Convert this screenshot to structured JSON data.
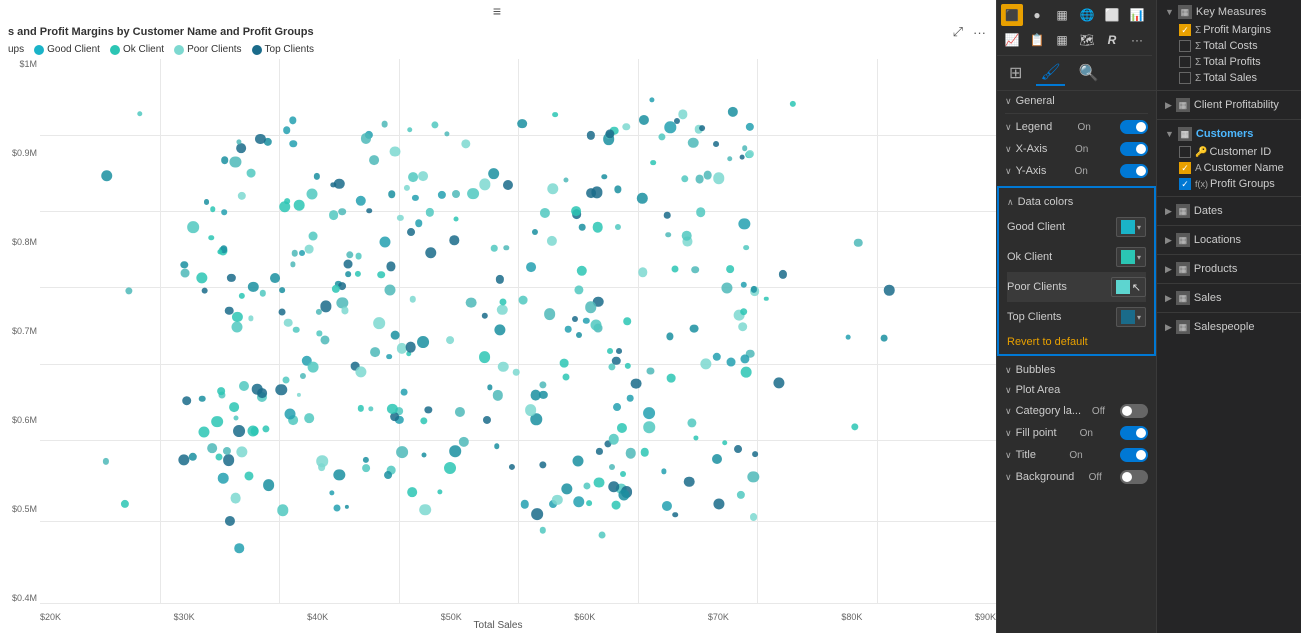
{
  "chart": {
    "title": "s and Profit Margins by Customer Name and Profit Groups",
    "x_axis_title": "Total Sales",
    "x_labels": [
      "$20K",
      "$30K",
      "$40K",
      "$50K",
      "$60K",
      "$70K",
      "$80K",
      "$90K"
    ],
    "legend_label": "ups",
    "legend_items": [
      {
        "label": "Good Client",
        "color": "#1ab3c8"
      },
      {
        "label": "Ok Client",
        "color": "#2bc5b4"
      },
      {
        "label": "Poor Clients",
        "color": "#5dd5d0"
      },
      {
        "label": "Top Clients",
        "color": "#1a6b8a"
      }
    ]
  },
  "format_panel": {
    "sections": [
      {
        "id": "general",
        "label": "General",
        "chevron": "∨",
        "type": "expand"
      },
      {
        "id": "legend",
        "label": "Legend",
        "chevron": "∨",
        "toggle": "on",
        "type": "toggle"
      },
      {
        "id": "x_axis",
        "label": "X-Axis",
        "chevron": "∨",
        "toggle": "on",
        "type": "toggle"
      },
      {
        "id": "y_axis",
        "label": "Y-Axis",
        "chevron": "∨",
        "toggle": "on",
        "type": "toggle"
      }
    ],
    "data_colors": {
      "header": "Data colors",
      "items": [
        {
          "label": "Good Client",
          "color": "#1ab3c8"
        },
        {
          "label": "Ok Client",
          "color": "#2bc5b4"
        },
        {
          "label": "Poor Clients",
          "color": "#5dd5d0"
        },
        {
          "label": "Top Clients",
          "color": "#1a6b8a"
        }
      ],
      "revert_label": "Revert to default"
    },
    "bottom_sections": [
      {
        "id": "bubbles",
        "label": "Bubbles",
        "chevron": "∨",
        "type": "expand"
      },
      {
        "id": "plot_area",
        "label": "Plot Area",
        "chevron": "∨",
        "type": "expand"
      },
      {
        "id": "category_label",
        "label": "Category la...",
        "chevron": "∨",
        "toggle": "off",
        "type": "toggle"
      },
      {
        "id": "fill_point",
        "label": "Fill point",
        "chevron": "∨",
        "toggle": "on",
        "type": "toggle"
      },
      {
        "id": "title",
        "label": "Title",
        "chevron": "∨",
        "toggle": "on",
        "type": "toggle"
      },
      {
        "id": "background",
        "label": "Background",
        "chevron": "∨",
        "toggle": "off",
        "type": "toggle"
      }
    ]
  },
  "field_list": {
    "sections": [
      {
        "id": "key_measures",
        "label": "Key Measures",
        "expanded": true,
        "chevron": "▼",
        "items": [
          {
            "label": "Profit Margins",
            "checked": true,
            "check_type": "yellow",
            "type": "measure"
          },
          {
            "label": "Total Costs",
            "checked": false,
            "type": "measure"
          },
          {
            "label": "Total Profits",
            "checked": false,
            "type": "measure"
          },
          {
            "label": "Total Sales",
            "checked": false,
            "type": "measure"
          }
        ]
      },
      {
        "id": "client_profitability",
        "label": "Client Profitability",
        "expanded": false,
        "chevron": "▶"
      },
      {
        "id": "customers",
        "label": "Customers",
        "expanded": true,
        "chevron": "▼",
        "highlighted": true,
        "items": [
          {
            "label": "Customer ID",
            "checked": false,
            "type": "field"
          },
          {
            "label": "Customer Name",
            "checked": true,
            "check_type": "yellow",
            "type": "field"
          },
          {
            "label": "Profit Groups",
            "checked": true,
            "check_type": "special",
            "type": "field"
          }
        ]
      },
      {
        "id": "dates",
        "label": "Dates",
        "expanded": false,
        "chevron": "▶"
      },
      {
        "id": "locations",
        "label": "Locations",
        "expanded": false,
        "chevron": "▶"
      },
      {
        "id": "products",
        "label": "Products",
        "expanded": false,
        "chevron": "▶"
      },
      {
        "id": "sales",
        "label": "Sales",
        "expanded": false,
        "chevron": "▶"
      },
      {
        "id": "salespeople",
        "label": "Salespeople",
        "expanded": false,
        "chevron": "▶"
      }
    ]
  },
  "toolbar": {
    "icons": [
      "⬛",
      "●",
      "▦",
      "🌐",
      "⬛",
      "📊",
      "📈",
      "📋",
      "▦",
      "🗺",
      "⬛",
      "⬛",
      "⬛",
      "⬛",
      "⬛",
      "⬛",
      "⬛",
      "⬛",
      "⬛",
      "⬛",
      "⬛"
    ],
    "format_tabs": [
      "fields",
      "format",
      "analytics"
    ]
  }
}
